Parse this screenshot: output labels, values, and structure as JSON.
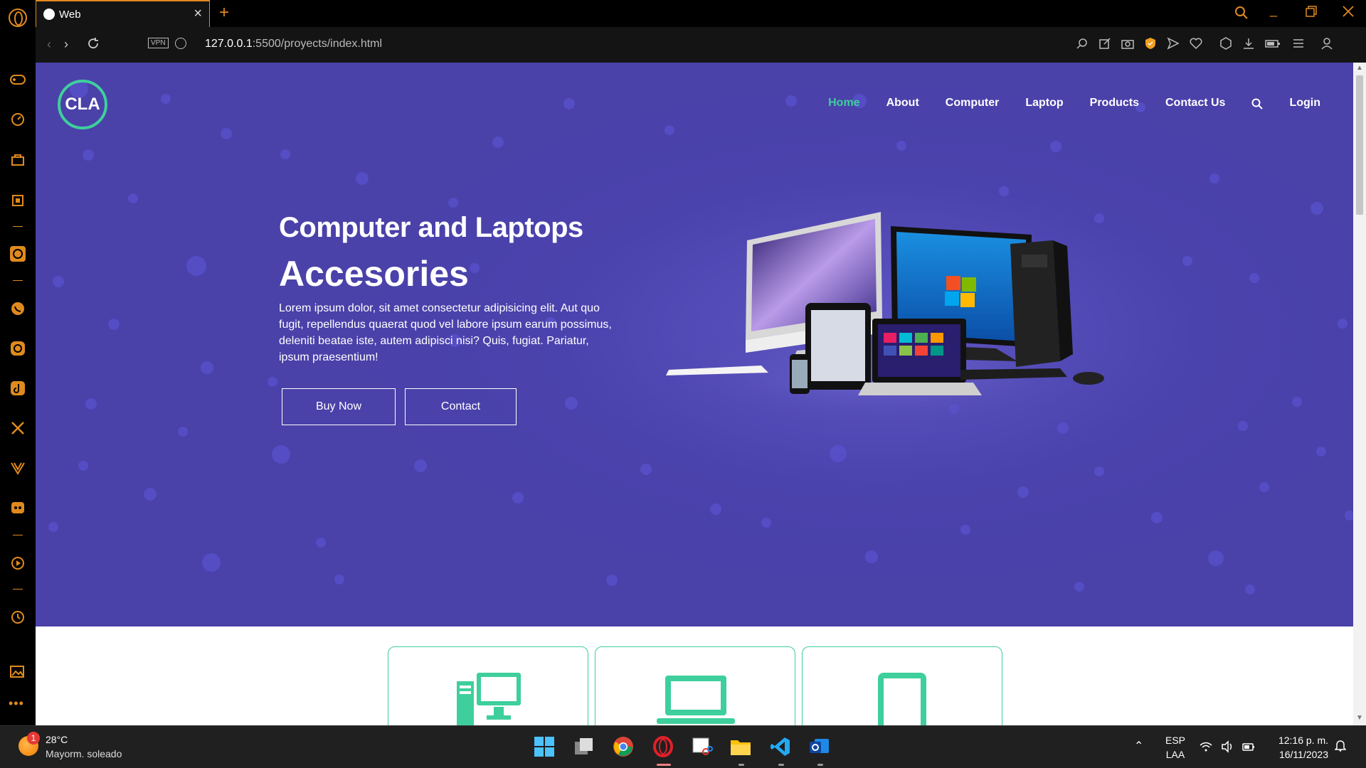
{
  "browser": {
    "tab_title": "Web",
    "url_host": "127.0.0.1",
    "url_path": ":5500/proyects/index.html",
    "vpn_label": "VPN"
  },
  "site": {
    "logo": "CLA",
    "nav": [
      "Home",
      "About",
      "Computer",
      "Laptop",
      "Products",
      "Contact Us"
    ],
    "login": "Login",
    "active_nav": "Home",
    "accent_color": "#3ecf9c",
    "hero_bg_color": "#4a41a9"
  },
  "hero": {
    "title": "Computer and Laptops",
    "subtitle": "Accesories",
    "text": "Lorem ipsum dolor, sit amet consectetur adipisicing elit. Aut quo fugit, repellendus quaerat quod vel labore ipsum earum possimus, deleniti beatae iste, autem adipisci nisi? Quis, fugiat. Pariatur, ipsum praesentium!",
    "buy_button": "Buy Now",
    "contact_button": "Contact"
  },
  "categories": [
    {
      "icon": "desktop-computer-icon"
    },
    {
      "icon": "laptop-icon"
    },
    {
      "icon": "tablet-icon"
    }
  ],
  "taskbar": {
    "weather_temp": "28°C",
    "weather_desc": "Mayorm. soleado",
    "weather_badge": "1",
    "lang_top": "ESP",
    "lang_bottom": "LAA",
    "time": "12:16 p. m.",
    "date": "16/11/2023"
  }
}
